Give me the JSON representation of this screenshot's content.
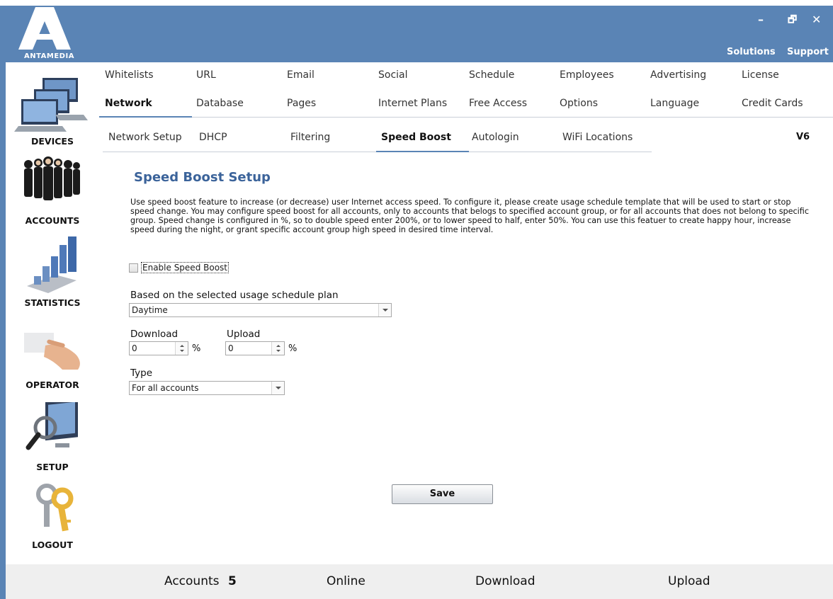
{
  "brand": {
    "logo_text": "ANTAMEDIA"
  },
  "window": {
    "minimize": "–",
    "restore": "🗗",
    "close": "✕"
  },
  "top_links": {
    "solutions": "Solutions",
    "support": "Support"
  },
  "sidebar": {
    "items": [
      {
        "label": "DEVICES",
        "icon": "devices-icon"
      },
      {
        "label": "ACCOUNTS",
        "icon": "accounts-icon"
      },
      {
        "label": "STATISTICS",
        "icon": "statistics-icon"
      },
      {
        "label": "OPERATOR",
        "icon": "operator-icon"
      },
      {
        "label": "SETUP",
        "icon": "setup-icon"
      },
      {
        "label": "LOGOUT",
        "icon": "logout-icon"
      }
    ]
  },
  "nav": {
    "row1": [
      "Whitelists",
      "URL",
      "Email",
      "Social",
      "Schedule",
      "Employees",
      "Advertising",
      "License"
    ],
    "row2": [
      "Network",
      "Database",
      "Pages",
      "Internet Plans",
      "Free Access",
      "Options",
      "Language",
      "Credit Cards"
    ],
    "row2_active": "Network",
    "subtabs": [
      "Network Setup",
      "DHCP",
      "Filtering",
      "Speed Boost",
      "Autologin",
      "WiFi Locations"
    ],
    "subtab_active": "Speed Boost",
    "version": "V6"
  },
  "content": {
    "title": "Speed Boost Setup",
    "description": "Use speed boost feature to increase (or decrease) user Internet access speed. To configure it, please create usage schedule template that will be used to start or stop speed change. You may configure speed boost for all accounts, only to accounts that belogs to specified account group, or for all accounts that does not belong to specific group. Speed change is configured in %, so to double speed enter 200%, or to lower speed to half, enter 50%. You can use this featuer to create happy hour, increase speed during the night, or grant specific account group high speed in desired time interval.",
    "enable_label": "Enable Speed Boost",
    "enable_checked": false,
    "schedule_label": "Based on the selected usage schedule plan",
    "schedule_value": "Daytime",
    "download_label": "Download",
    "download_value": "0",
    "upload_label": "Upload",
    "upload_value": "0",
    "percent_sign": "%",
    "type_label": "Type",
    "type_value": "For all accounts",
    "save_label": "Save"
  },
  "footer": {
    "accounts_label": "Accounts",
    "accounts_count": "5",
    "online_label": "Online",
    "download_label": "Download",
    "upload_label": "Upload"
  },
  "colors": {
    "accent": "#5a84b5",
    "title": "#3b639a"
  }
}
